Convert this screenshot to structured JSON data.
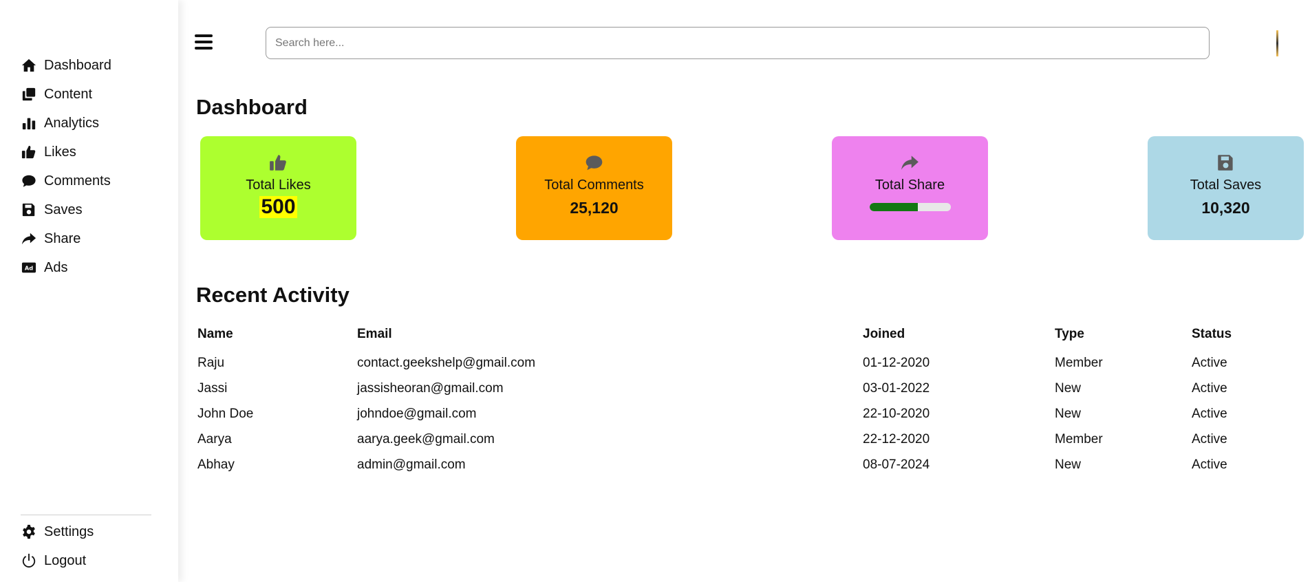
{
  "sidebar": {
    "items": [
      {
        "label": "Dashboard",
        "icon": "home-icon"
      },
      {
        "label": "Content",
        "icon": "copy-icon"
      },
      {
        "label": "Analytics",
        "icon": "bar-chart-icon"
      },
      {
        "label": "Likes",
        "icon": "thumbs-up-icon"
      },
      {
        "label": "Comments",
        "icon": "comment-icon"
      },
      {
        "label": "Saves",
        "icon": "floppy-disk-icon"
      },
      {
        "label": "Share",
        "icon": "share-arrow-icon"
      },
      {
        "label": "Ads",
        "icon": "ad-icon"
      }
    ],
    "bottom_items": [
      {
        "label": "Settings",
        "icon": "gear-icon"
      },
      {
        "label": "Logout",
        "icon": "power-icon"
      }
    ]
  },
  "topbar": {
    "search_placeholder": "Search here...",
    "menu_icon": "hamburger-icon"
  },
  "dashboard": {
    "title": "Dashboard",
    "cards": [
      {
        "label": "Total Likes",
        "value": "500",
        "icon": "thumbs-up-icon",
        "color": "#adff2f"
      },
      {
        "label": "Total Comments",
        "value": "25,120",
        "icon": "comment-icon",
        "color": "#ffa500"
      },
      {
        "label": "Total Share",
        "progress": 0.6,
        "icon": "share-arrow-icon",
        "color": "#ee82ee"
      },
      {
        "label": "Total Saves",
        "value": "10,320",
        "icon": "floppy-disk-icon",
        "color": "#add8e6"
      }
    ]
  },
  "recent": {
    "title": "Recent Activity",
    "columns": [
      "Name",
      "Email",
      "Joined",
      "Type",
      "Status"
    ],
    "rows": [
      [
        "Raju",
        "contact.geekshelp@gmail.com",
        "01-12-2020",
        "Member",
        "Active"
      ],
      [
        "Jassi",
        "jassisheoran@gmail.com",
        "03-01-2022",
        "New",
        "Active"
      ],
      [
        "John Doe",
        "johndoe@gmail.com",
        "22-10-2020",
        "New",
        "Active"
      ],
      [
        "Aarya",
        "aarya.geek@gmail.com",
        "22-12-2020",
        "Member",
        "Active"
      ],
      [
        "Abhay",
        "admin@gmail.com",
        "08-07-2024",
        "New",
        "Active"
      ]
    ]
  }
}
